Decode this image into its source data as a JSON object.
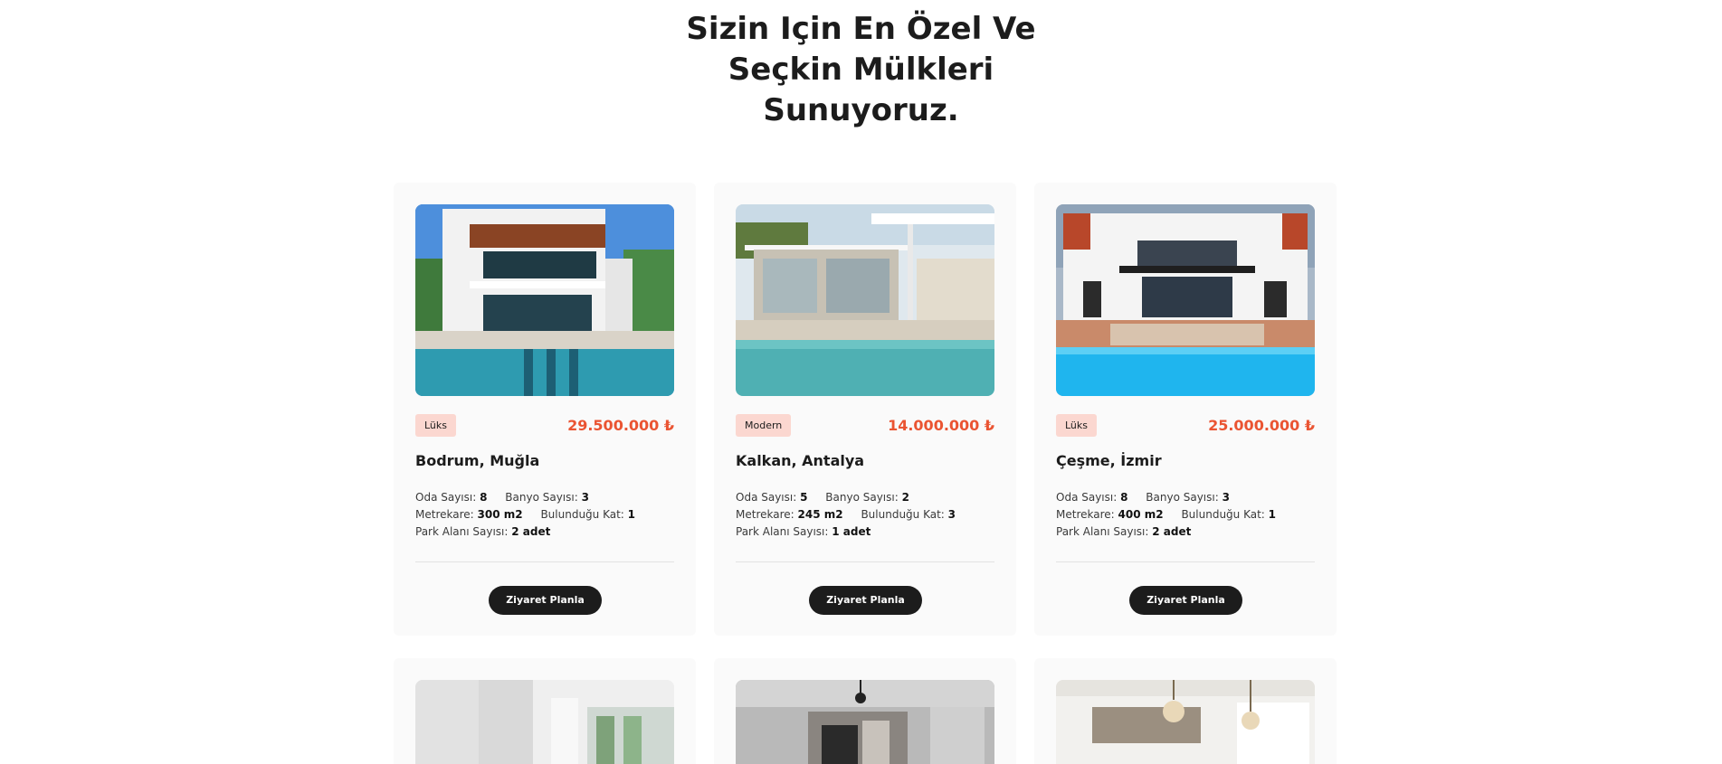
{
  "heading": {
    "line1": "Sizin Için En Özel Ve",
    "line2": "Seçkin Mülkleri",
    "line3": "Sunuyoruz."
  },
  "colors": {
    "price": "#ea5432",
    "badge_bg": "#fbd7d0",
    "button_bg": "#1c1c1c",
    "card_bg": "#fafafa"
  },
  "spec_labels": {
    "rooms": "Oda Sayısı:",
    "baths": "Banyo Sayısı:",
    "area": "Metrekare:",
    "floor": "Bulunduğu Kat:",
    "parking": "Park Alanı Sayısı:"
  },
  "listings": [
    {
      "badge": "Lüks",
      "price": "29.500.000 ₺",
      "location": "Bodrum, Muğla",
      "rooms": "8",
      "baths": "3",
      "area": "300 m2",
      "floor": "1",
      "parking": "2 adet",
      "button": "Ziyaret Planla",
      "image": "modern-villa-pool-photo"
    },
    {
      "badge": "Modern",
      "price": "14.000.000 ₺",
      "location": "Kalkan, Antalya",
      "rooms": "5",
      "baths": "2",
      "area": "245 m2",
      "floor": "3",
      "parking": "1 adet",
      "button": "Ziyaret Planla",
      "image": "glass-villa-pool-photo"
    },
    {
      "badge": "Lüks",
      "price": "25.000.000 ₺",
      "location": "Çeşme, İzmir",
      "rooms": "8",
      "baths": "3",
      "area": "400 m2",
      "floor": "1",
      "parking": "2 adet",
      "button": "Ziyaret Planla",
      "image": "white-villa-pool-photo"
    }
  ],
  "lower_row_images": [
    "bright-interior-photo",
    "living-room-photo",
    "white-kitchen-photo"
  ]
}
